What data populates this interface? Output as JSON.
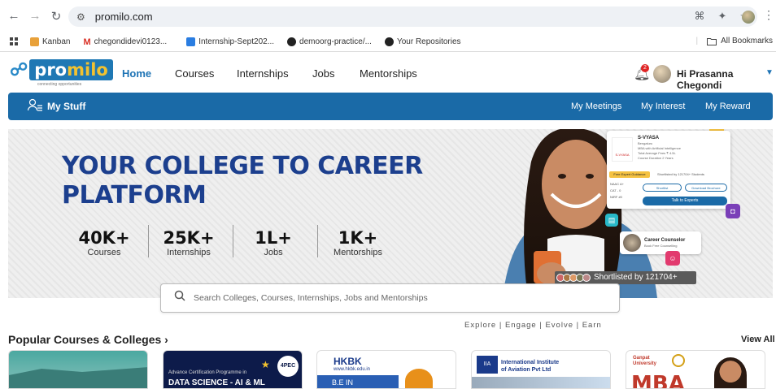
{
  "browser": {
    "url": "promilo.com",
    "bookmarks": [
      {
        "label": "Kanban"
      },
      {
        "label": "chegondidevi0123..."
      },
      {
        "label": "Internship-Sept202..."
      },
      {
        "label": "demoorg-practice/..."
      },
      {
        "label": "Your Repositories"
      }
    ],
    "all_bookmarks": "All Bookmarks"
  },
  "header": {
    "logo_text_a": "pro",
    "logo_text_b": "milo",
    "logo_tagline": "connecting opportunities",
    "nav": [
      {
        "label": "Home",
        "active": true
      },
      {
        "label": "Courses"
      },
      {
        "label": "Internships"
      },
      {
        "label": "Jobs"
      },
      {
        "label": "Mentorships"
      }
    ],
    "notification_count": "2",
    "greeting": "Hi Prasanna Chegondi"
  },
  "mystuff": {
    "label": "My Stuff",
    "links": [
      "My Meetings",
      "My Interest",
      "My Reward"
    ]
  },
  "hero": {
    "title": "YOUR COLLEGE TO CAREER PLATFORM",
    "stats": [
      {
        "value": "40K+",
        "label": "Courses"
      },
      {
        "value": "25K+",
        "label": "Internships"
      },
      {
        "value": "1L+",
        "label": "Jobs"
      },
      {
        "value": "1K+",
        "label": "Mentorships"
      }
    ],
    "college_card": {
      "name": "S-VYASA",
      "city": "Bengaluru",
      "line1": "MBA with Artificial Intelligence",
      "line2": "Total Average Fees",
      "line3": "₹ 4.5L",
      "line4": "Course Duration",
      "line5": "2 Years",
      "badge": "Free Expert Guidance",
      "shortlisted": "Shortlisted by 121704+ Students",
      "meta": [
        "NAAC A+",
        "CAT - 0",
        "NIRF #0"
      ],
      "btn_shortlist": "Shortlist",
      "btn_brochure": "Download Brochure",
      "btn_expert": "Talk to Experts",
      "logo_label": "S-VYASA"
    },
    "counsellor": {
      "title": "Career Counselor",
      "subtitle": "Book Free Counselling"
    },
    "shortlisted_text": "Shortlisted by 121704+ Users"
  },
  "search": {
    "placeholder": "Search Colleges, Courses, Internships, Jobs and Mentorships"
  },
  "tagline": "Explore | Engage | Evolve | Earn",
  "popular": {
    "title": "Popular Courses & Colleges",
    "view_all": "View All",
    "cards": [
      {
        "t1": "",
        "t2": ""
      },
      {
        "t1": "Advance Certification Programme in",
        "t2": "DATA SCIENCE - AI & ML",
        "badge": "4PEC"
      },
      {
        "t1": "HKBK",
        "t2": "www.hkbk.edu.in",
        "t3": "B.E IN"
      },
      {
        "t1": "International Institute",
        "t2": "of Aviation Pvt Ltd"
      },
      {
        "t1": "Ganpat University",
        "t2": "MBA"
      }
    ]
  },
  "colors": {
    "brand": "#1a6aa7",
    "accent": "#f2c230",
    "hero_title": "#1c3f8e"
  }
}
